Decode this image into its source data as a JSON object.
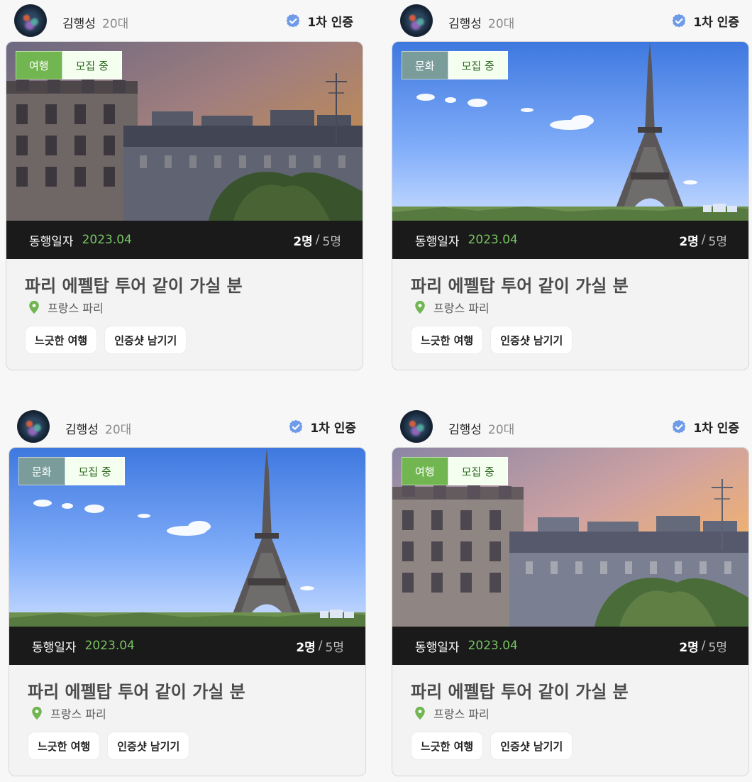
{
  "colors": {
    "background": "#f7f7f7",
    "accent": "#77c461",
    "travel_tag": "#72b651",
    "culture_tag": "#7a9d9c",
    "verify": "#6f9be8",
    "info_bar": "#1a1a1b"
  },
  "cards": [
    {
      "author": {
        "name": "김행성",
        "age": "20대",
        "verification": "1차 인증"
      },
      "image": "paris-rooftops-sunset",
      "category": {
        "label": "여행",
        "color": "#72b651"
      },
      "status": "모집 중",
      "date_label": "동행일자",
      "date": "2023.04",
      "people": {
        "current": "2명",
        "separator": "/",
        "total": "5명"
      },
      "title": "파리 에펠탑 투어 같이 가실 분",
      "location": "프랑스 파리",
      "tags": [
        "느긋한 여행",
        "인증샷 남기기"
      ],
      "overlay_opacity": 0.22
    },
    {
      "author": {
        "name": "김행성",
        "age": "20대",
        "verification": "1차 인증"
      },
      "image": "eiffel-tower-daytime",
      "category": {
        "label": "문화",
        "color": "#7a9d9c"
      },
      "status": "모집 중",
      "date_label": "동행일자",
      "date": "2023.04",
      "people": {
        "current": "2명",
        "separator": "/",
        "total": "5명"
      },
      "title": "파리 에펠탑 투어 같이 가실 분",
      "location": "프랑스 파리",
      "tags": [
        "느긋한 여행",
        "인증샷 남기기"
      ],
      "overlay_opacity": 0
    },
    {
      "author": {
        "name": "김행성",
        "age": "20대",
        "verification": "1차 인증"
      },
      "image": "eiffel-tower-daytime",
      "category": {
        "label": "문화",
        "color": "#7a9d9c"
      },
      "status": "모집 중",
      "date_label": "동행일자",
      "date": "2023.04",
      "people": {
        "current": "2명",
        "separator": "/",
        "total": "5명"
      },
      "title": "파리 에펠탑 투어 같이 가실 분",
      "location": "프랑스 파리",
      "tags": [
        "느긋한 여행",
        "인증샷 남기기"
      ],
      "overlay_opacity": 0
    },
    {
      "author": {
        "name": "김행성",
        "age": "20대",
        "verification": "1차 인증"
      },
      "image": "paris-rooftops-sunset",
      "category": {
        "label": "여행",
        "color": "#72b651"
      },
      "status": "모집 중",
      "date_label": "동행일자",
      "date": "2023.04",
      "people": {
        "current": "2명",
        "separator": "/",
        "total": "5명"
      },
      "title": "파리 에펠탑 투어 같이 가실 분",
      "location": "프랑스 파리",
      "tags": [
        "느긋한 여행",
        "인증샷 남기기"
      ],
      "overlay_opacity": 0
    }
  ]
}
